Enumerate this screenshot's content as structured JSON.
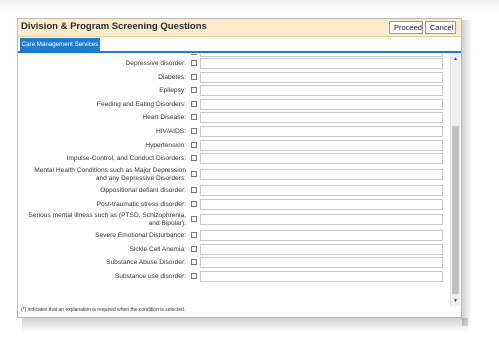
{
  "dialog": {
    "title": "Division & Program Screening Questions",
    "proceed_label": "Proceed",
    "cancel_label": "Cancel"
  },
  "tabs": [
    {
      "label": "Care Management Services"
    }
  ],
  "conditions": [
    {
      "label": "Depressive disorder:"
    },
    {
      "label": "Diabetes:"
    },
    {
      "label": "Epilepsy:"
    },
    {
      "label": "Feeding and Eating Disorders:"
    },
    {
      "label": "Heart Disease:"
    },
    {
      "label": "HIV/AIDS:"
    },
    {
      "label": "Hypertension:"
    },
    {
      "label": "Impulse-Control, and Conduct Disorders:"
    },
    {
      "label": "Mental Health Conditions such as Major Depression",
      "label2": "and any Depressive Disorders:"
    },
    {
      "label": "Oppositional defiant disorder:"
    },
    {
      "label": "Post-traumatic stress disorder:"
    },
    {
      "label": "Serious mental illness such as (PTSD, Schizophrenia,",
      "label2": "and Bipolar):"
    },
    {
      "label": "Severe Emotional Disturbance:"
    },
    {
      "label": "Sickle Cell Anemia:"
    },
    {
      "label": "Substance Abuse Disorder:"
    },
    {
      "label": "Substance use disorder:"
    }
  ],
  "footnote": "(*) indicates that an explanation is required when the condition is selected.",
  "icons": {
    "scroll_up": "▲",
    "scroll_down": "▼"
  }
}
